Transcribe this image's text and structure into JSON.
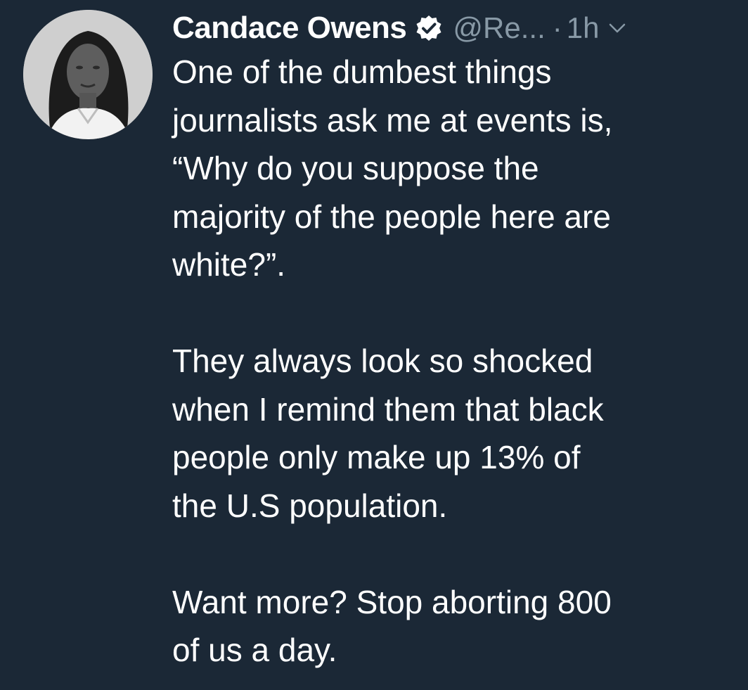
{
  "tweet": {
    "author": {
      "name": "Candace Owens",
      "handle": "@Re...",
      "verified": true,
      "avatar_icon": "avatar-photo"
    },
    "separator": "·",
    "time": "1h",
    "menu_icon": "chevron-down-icon",
    "paragraphs": [
      {
        "lines": [
          "One of the dumbest things",
          "journalists ask me at events is,",
          "“Why do you suppose the",
          "majority of the people here are",
          "white?”."
        ]
      },
      {
        "lines": [
          "They always look so shocked",
          "when I remind them that black",
          "people only make up 13% of",
          "the U.S population."
        ]
      },
      {
        "lines": [
          "Want more? Stop aborting 800",
          "of us a day."
        ]
      }
    ]
  },
  "colors": {
    "background": "#1b2836",
    "text": "#ffffff",
    "secondary_text": "#8899a6"
  }
}
